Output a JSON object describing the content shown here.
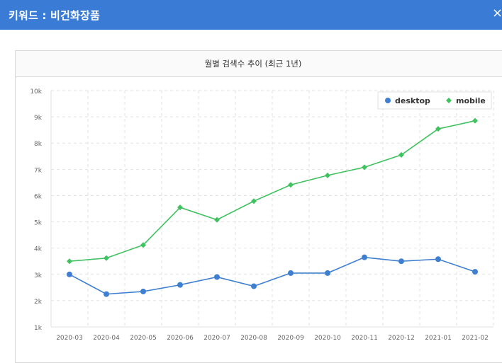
{
  "header": {
    "title": "키워드 : 비건화장품",
    "close_label": "×"
  },
  "chart_panel": {
    "title": "월별 검색수 추이 (최근 1년)"
  },
  "colors": {
    "header_bg": "#3a7bd5",
    "desktop": "#3f7fd0",
    "mobile": "#3fc25f"
  },
  "chart_data": {
    "type": "line",
    "title": "월별 검색수 추이 (최근 1년)",
    "categories": [
      "2020-03",
      "2020-04",
      "2020-05",
      "2020-06",
      "2020-07",
      "2020-08",
      "2020-09",
      "2020-10",
      "2020-11",
      "2020-12",
      "2021-01",
      "2021-02"
    ],
    "y_ticks": [
      "1k",
      "2k",
      "3k",
      "4k",
      "5k",
      "6k",
      "7k",
      "8k",
      "9k",
      "10k"
    ],
    "ylim": [
      1000,
      10000
    ],
    "grid": true,
    "legend_position": "top-right",
    "series": [
      {
        "name": "desktop",
        "values": [
          3000,
          2250,
          2350,
          2600,
          2900,
          2550,
          3050,
          3050,
          3650,
          3500,
          3580,
          3100
        ]
      },
      {
        "name": "mobile",
        "values": [
          3500,
          3620,
          4120,
          5550,
          5080,
          5790,
          6410,
          6770,
          7080,
          7550,
          8540,
          8850
        ]
      }
    ]
  }
}
